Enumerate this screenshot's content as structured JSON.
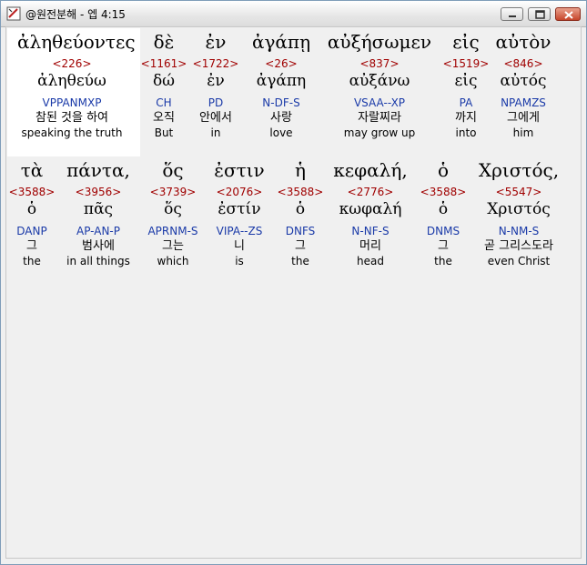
{
  "window": {
    "title": "@원전분해 - 엡 4:15",
    "icon": "app-icon",
    "controls": [
      "minimize",
      "maximize",
      "close"
    ]
  },
  "rows": [
    [
      {
        "greek": "ἀληθεύοντες",
        "strong": "<226>",
        "lemma": "ἀληθεύω",
        "parse": "VPPANMXP",
        "korean": "참된 것을 하여",
        "english": "speaking the truth"
      },
      {
        "greek": "δὲ",
        "strong": "<1161>",
        "lemma": "δώ",
        "parse": "CH",
        "korean": "오직",
        "english": "But"
      },
      {
        "greek": "ἐν",
        "strong": "<1722>",
        "lemma": "ἐν",
        "parse": "PD",
        "korean": "안에서",
        "english": "in"
      },
      {
        "greek": "ἀγάπῃ",
        "strong": "<26>",
        "lemma": "ἀγάπη",
        "parse": "N-DF-S",
        "korean": "사랑",
        "english": "love"
      },
      {
        "greek": "αὐξήσωμεν",
        "strong": "<837>",
        "lemma": "αὐξάνω",
        "parse": "VSAA--XP",
        "korean": "자랄찌라",
        "english": "may grow up"
      },
      {
        "greek": "εἰς",
        "strong": "<1519>",
        "lemma": "εἰς",
        "parse": "PA",
        "korean": "까지",
        "english": "into"
      },
      {
        "greek": "αὐτὸν",
        "strong": "<846>",
        "lemma": "αὐτός",
        "parse": "NPAMZS",
        "korean": "그에게",
        "english": "him"
      }
    ],
    [
      {
        "greek": "τὰ",
        "strong": "<3588>",
        "lemma": "ὁ",
        "parse": "DANP",
        "korean": "그",
        "english": "the"
      },
      {
        "greek": "πάντα,",
        "strong": "<3956>",
        "lemma": "πᾶς",
        "parse": "AP-AN-P",
        "korean": "범사에",
        "english": "in all things"
      },
      {
        "greek": "ὅς",
        "strong": "<3739>",
        "lemma": "ὅς",
        "parse": "APRNM-S",
        "korean": "그는",
        "english": "which"
      },
      {
        "greek": "ἐστιν",
        "strong": "<2076>",
        "lemma": "ἐστίν",
        "parse": "VIPA--ZS",
        "korean": "니",
        "english": "is"
      },
      {
        "greek": "ἡ",
        "strong": "<3588>",
        "lemma": "ὁ",
        "parse": "DNFS",
        "korean": "그",
        "english": "the"
      },
      {
        "greek": "κεφαλή,",
        "strong": "<2776>",
        "lemma": "κωφαλή",
        "parse": "N-NF-S",
        "korean": "머리",
        "english": "head"
      },
      {
        "greek": "ὁ",
        "strong": "<3588>",
        "lemma": "ὁ",
        "parse": "DNMS",
        "korean": "그",
        "english": "the"
      },
      {
        "greek": "Χριστός,",
        "strong": "<5547>",
        "lemma": "Χριστός",
        "parse": "N-NM-S",
        "korean": "곧 그리스도라",
        "english": "even Christ"
      }
    ]
  ]
}
